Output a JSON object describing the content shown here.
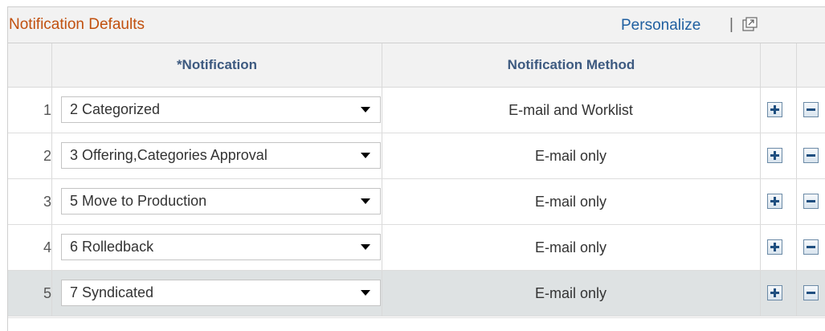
{
  "grid": {
    "title": "Notification Defaults",
    "personalize": "Personalize",
    "separator": "|",
    "popout_icon": "new-window-icon",
    "columns": {
      "notification": "*Notification",
      "method": "Notification Method"
    },
    "rows": [
      {
        "num": "1",
        "notification": "2 Categorized",
        "method": "E-mail and Worklist"
      },
      {
        "num": "2",
        "notification": "3 Offering,Categories Approval",
        "method": "E-mail only"
      },
      {
        "num": "3",
        "notification": "5 Move to Production",
        "method": "E-mail only"
      },
      {
        "num": "4",
        "notification": "6 Rolledback",
        "method": "E-mail only"
      },
      {
        "num": "5",
        "notification": "7 Syndicated",
        "method": "E-mail only"
      }
    ],
    "selected_row": 5
  },
  "colors": {
    "title": "#c1500e",
    "link": "#1f5fa0",
    "header_text": "#3d5a80",
    "selected_row_bg": "#dee2e3"
  }
}
